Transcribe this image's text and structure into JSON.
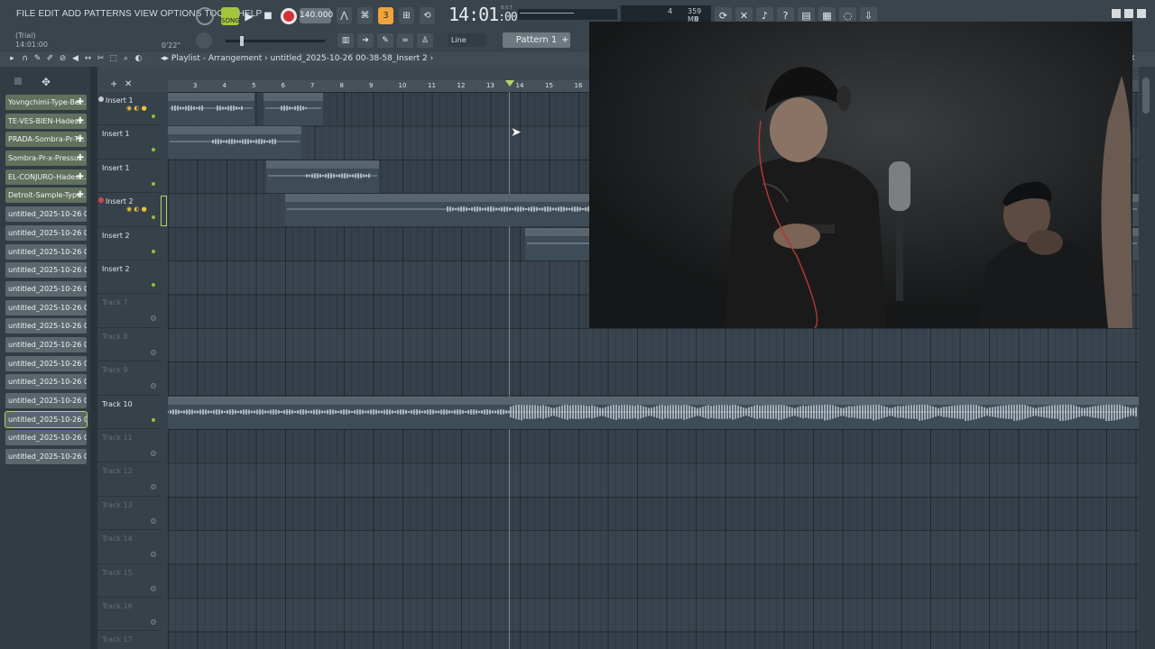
{
  "menu": [
    "FILE",
    "EDIT",
    "ADD",
    "PATTERNS",
    "VIEW",
    "OPTIONS",
    "TOOLS",
    "HELP"
  ],
  "hint": {
    "line1": "(Trial)",
    "line2": "14:01:00",
    "elapsed": "0'22\""
  },
  "transport": {
    "song_label": "SONG",
    "tempo": "140.000",
    "clock": "14:01",
    "clock_sub": ":00",
    "clock_tiny": "B:S:T"
  },
  "cpu": "4",
  "memory": "359 MB",
  "memory2": "0",
  "snap": "Line",
  "pattern": "Pattern 1",
  "playlist_title": "Playlist - Arrangement",
  "breadcrumb": "untitled_2025-10-26 00-38-58_Insert 2",
  "browser_clips": [
    {
      "label": "Yovngchimi-Type-Be...",
      "audio": true
    },
    {
      "label": "TE-VES-BIEN-Hades...",
      "audio": true
    },
    {
      "label": "PRADA-Sombra-Pr-T...",
      "audio": true
    },
    {
      "label": "Sombra-Pr-x-Pressu...",
      "audio": true
    },
    {
      "label": "EL-CONJURO-Hades-...",
      "audio": true
    },
    {
      "label": "Detroit-Sample-Type...",
      "audio": true
    },
    {
      "label": "untitled_2025-10-26 00-...",
      "audio": false
    },
    {
      "label": "untitled_2025-10-26 00-...",
      "audio": false
    },
    {
      "label": "untitled_2025-10-26 00-...",
      "audio": false
    },
    {
      "label": "untitled_2025-10-26 00-...",
      "audio": false
    },
    {
      "label": "untitled_2025-10-26 00-...",
      "audio": false
    },
    {
      "label": "untitled_2025-10-26 00-...",
      "audio": false
    },
    {
      "label": "untitled_2025-10-26 00-...",
      "audio": false
    },
    {
      "label": "untitled_2025-10-26 00-...",
      "audio": false
    },
    {
      "label": "untitled_2025-10-26 00-...",
      "audio": false
    },
    {
      "label": "untitled_2025-10-26 00-...",
      "audio": false
    },
    {
      "label": "untitled_2025-10-26 00-...",
      "audio": false
    },
    {
      "label": "untitled_2025-10-26 00-...",
      "audio": false,
      "selected": true
    },
    {
      "label": "untitled_2025-10-26 00-...",
      "audio": false
    },
    {
      "label": "untitled_2025-10-26 00-...",
      "audio": false
    }
  ],
  "tracks": [
    {
      "name": "Insert 1",
      "active": true,
      "controls": true
    },
    {
      "name": "Insert 1",
      "active": true
    },
    {
      "name": "Insert 1",
      "active": true
    },
    {
      "name": "Insert 2",
      "active": true,
      "controls": true,
      "removed": true
    },
    {
      "name": "Insert 2",
      "active": true
    },
    {
      "name": "Insert 2",
      "active": true
    },
    {
      "name": "Track 7",
      "active": false
    },
    {
      "name": "Track 8",
      "active": false
    },
    {
      "name": "Track 9",
      "active": false
    },
    {
      "name": "Track 10",
      "active": true
    },
    {
      "name": "Track 11",
      "active": false
    },
    {
      "name": "Track 12",
      "active": false
    },
    {
      "name": "Track 13",
      "active": false
    },
    {
      "name": "Track 14",
      "active": false
    },
    {
      "name": "Track 15",
      "active": false
    },
    {
      "name": "Track 16",
      "active": false
    },
    {
      "name": "Track 17",
      "active": false
    }
  ],
  "ruler": [
    "3",
    "4",
    "5",
    "6",
    "7",
    "8",
    "9",
    "10",
    "11",
    "12",
    "13",
    "14",
    "15",
    "16"
  ],
  "playlist_clips": [
    {
      "label": "untitled_2025...-47_Insert 1"
    },
    {
      "label": "untitled_..._Insert 1"
    },
    {
      "label": "untitled_2025-10-26 00-32-50_Insert 1"
    },
    {
      "label": "untitled_2025-10-...00-37-41_Insert 1"
    },
    {
      "label": "untitled_2025-10-26 00-38-58_Insert 2"
    },
    {
      "label": "untitled_2025-10-"
    },
    {
      "label": "EL-CONJURO-Hades-66-Type-Beat"
    }
  ]
}
